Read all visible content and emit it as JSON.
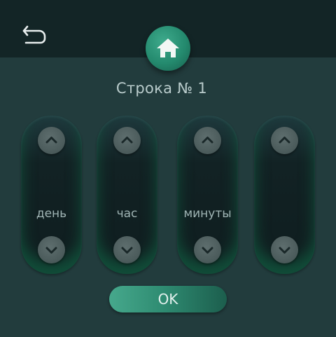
{
  "header": {
    "back_icon": "back-arrow-icon",
    "home_icon": "home-icon"
  },
  "title": "Строка № 1",
  "columns": [
    {
      "label": "день",
      "up_icon": "chevron-up-icon",
      "down_icon": "chevron-down-icon"
    },
    {
      "label": "час",
      "up_icon": "chevron-up-icon",
      "down_icon": "chevron-down-icon"
    },
    {
      "label": "минуты",
      "up_icon": "chevron-up-icon",
      "down_icon": "chevron-down-icon"
    },
    {
      "label": "",
      "up_icon": "chevron-up-icon",
      "down_icon": "chevron-down-icon"
    }
  ],
  "ok_label": "OK",
  "colors": {
    "background": "#223c3d",
    "topbar": "#132526",
    "accent": "#2f8c72"
  }
}
